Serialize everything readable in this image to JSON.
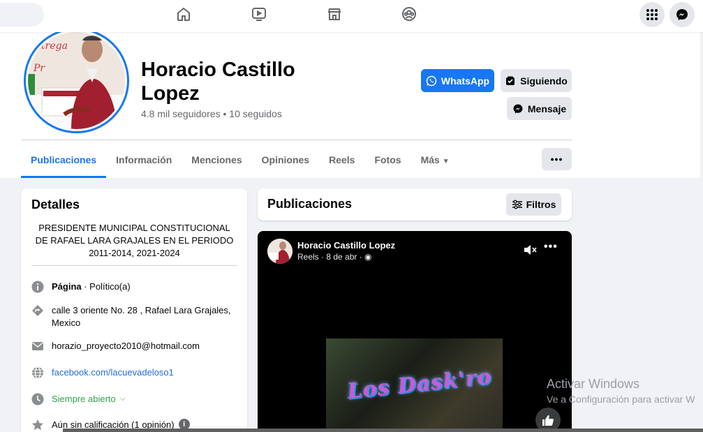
{
  "nav": {
    "icons": [
      "home-icon",
      "video-icon",
      "marketplace-icon",
      "groups-icon",
      "menu-grid-icon",
      "messenger-icon"
    ]
  },
  "profile": {
    "name": "Horacio Castillo Lopez",
    "followers": "4.8 mil seguidores • 10 seguidos",
    "whatsapp_label": "WhatsApp",
    "following_label": "Siguiendo",
    "message_label": "Mensaje"
  },
  "tabs": [
    "Publicaciones",
    "Información",
    "Menciones",
    "Opiniones",
    "Reels",
    "Fotos",
    "Más"
  ],
  "details": {
    "title": "Detalles",
    "bio": "PRESIDENTE MUNICIPAL CONSTITUCIONAL DE RAFAEL LARA GRAJALES EN EL PERIODO 2011-2014, 2021-2024",
    "page_label": "Página",
    "page_category": " · Político(a)",
    "address": "calle 3 oriente No. 28 , Rafael Lara Grajales, Mexico",
    "email": "horazio_proyecto2010@hotmail.com",
    "website": "facebook.com/lacuevadeloso1",
    "hours": "Siempre abierto",
    "rating": "Aún sin calificación (1 opinión)"
  },
  "posts_section": {
    "title": "Publicaciones",
    "filter_label": "Filtros"
  },
  "post": {
    "author": "Horacio Castillo Lopez",
    "meta": "Reels · 8 de abr · ",
    "video_logo": "Los Dask'ro"
  },
  "watermark": {
    "line1": "Activar Windows",
    "line2": "Ve a Configuración para activar W"
  }
}
